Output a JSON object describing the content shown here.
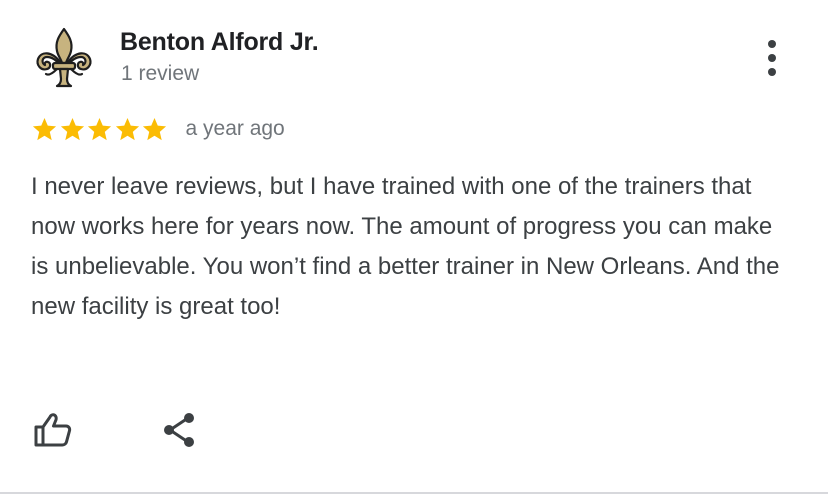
{
  "reviewer": {
    "name": "Benton Alford Jr.",
    "review_count": "1 review",
    "avatar_icon": "fleur-de-lis-icon"
  },
  "menu": {
    "icon": "more-vertical-icon"
  },
  "rating": {
    "stars": 5,
    "max_stars": 5,
    "star_color": "#fbbc04",
    "time_ago": "a year ago"
  },
  "review": {
    "text": "I never leave reviews, but I have trained with one of the trainers that now works here for years now. The amount of progress you can make is unbelievable. You won’t find a better trainer in New Orleans. And the new facility is great too!"
  },
  "actions": {
    "like_icon": "thumbs-up-icon",
    "share_icon": "share-icon"
  },
  "colors": {
    "name_text": "#202124",
    "secondary_text": "#70757a",
    "body_text": "#3c4043",
    "icon": "#3c4043",
    "avatar_gold": "#c7b37f",
    "avatar_outline": "#1e1e1e"
  }
}
